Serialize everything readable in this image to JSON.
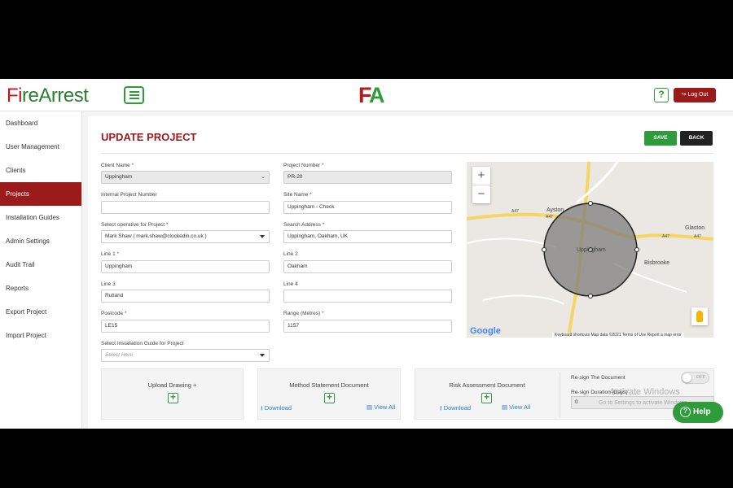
{
  "header": {
    "logo_part1": "F",
    "logo_part2": "i",
    "logo_part3": "reArrest",
    "brand_mark_f": "F",
    "brand_mark_a": "A",
    "help_glyph": "?",
    "logout_label": "Log Out"
  },
  "sidebar": {
    "items": [
      {
        "label": "Dashboard"
      },
      {
        "label": "User Management"
      },
      {
        "label": "Clients"
      },
      {
        "label": "Projects",
        "active": true
      },
      {
        "label": "Installation Guides"
      },
      {
        "label": "Admin Settings"
      },
      {
        "label": "Audit Trail"
      },
      {
        "label": "Reports"
      },
      {
        "label": "Export Project"
      },
      {
        "label": "Import Project"
      }
    ]
  },
  "page": {
    "title": "UPDATE PROJECT",
    "save_label": "SAVE",
    "back_label": "BACK"
  },
  "form": {
    "client_name": {
      "label": "Client Name",
      "value": "Uppingham"
    },
    "project_number": {
      "label": "Project Number",
      "value": "PR-20"
    },
    "internal_project_number": {
      "label": "Internal Project Number",
      "value": ""
    },
    "site_name": {
      "label": "Site Name",
      "value": "Uppingham - Check"
    },
    "operative": {
      "label": "Select operative for Project",
      "value": "Mark Shaw ( mark.shaw@clockedin.co.uk )"
    },
    "search_address": {
      "label": "Search Address",
      "value": "Uppingham, Oakham, UK"
    },
    "line1": {
      "label": "Line 1",
      "value": "Uppingham"
    },
    "line2": {
      "label": "Line 2",
      "value": "Oakham"
    },
    "line3": {
      "label": "Line 3",
      "value": "Rutland"
    },
    "line4": {
      "label": "Line 4",
      "value": ""
    },
    "postcode": {
      "label": "Postcode",
      "value": "LE15"
    },
    "range": {
      "label": "Range (Metres)",
      "value": "1157"
    },
    "installation_guide": {
      "label": "Select Installation Guide for Project",
      "placeholder": "Select Here"
    }
  },
  "map": {
    "places": [
      "Ayston",
      "Uppingham",
      "Bisbrooke",
      "Glaston",
      "A47",
      "A47",
      "A47",
      "A47"
    ],
    "footer": "Keyboard shortcuts   Map data ©2021   Terms of Use   Report a map error",
    "google_label": "Google",
    "zoom_in": "+",
    "zoom_out": "−",
    "colors": {
      "circle_fill": "#7d7d7d",
      "road": "#f6d565"
    }
  },
  "uploads": {
    "drawing": {
      "title": "Upload Drawing +"
    },
    "method_statement": {
      "title": "Method Statement Document",
      "download": "Download",
      "view_all": "View All"
    },
    "risk_assessment": {
      "title": "Risk Assessment Document",
      "download": "Download",
      "view_all": "View All"
    },
    "resign": {
      "label": "Re-sign The Document",
      "toggle": "OFF",
      "duration_label": "Re-sign Duration (Days)",
      "duration_value": "0"
    }
  },
  "watermark": {
    "line1": "Activate Windows",
    "line2": "Go to Settings to activate Windows."
  },
  "help_button": {
    "label": "Help"
  }
}
